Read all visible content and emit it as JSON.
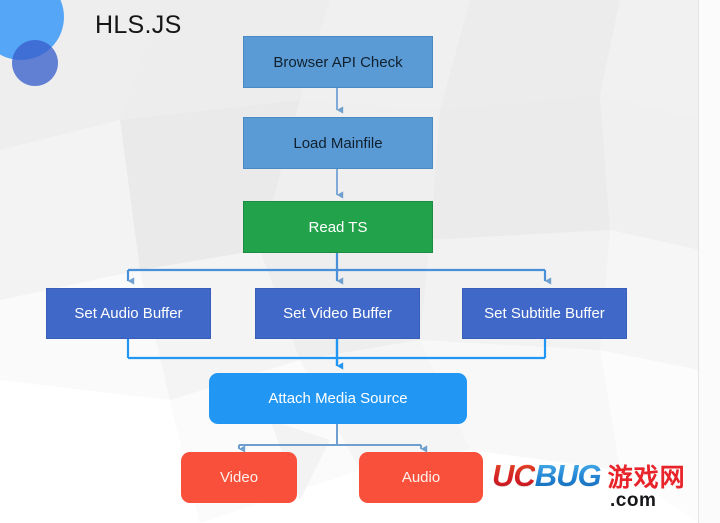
{
  "title": "HLS.JS",
  "colors": {
    "background": "#f2f2f2",
    "light_blue_box": "#5b9bd5",
    "green_box": "#22a24a",
    "indigo_box": "#4068c8",
    "bright_blue_box": "#2196f3",
    "red_box": "#f9503c",
    "connector_light": "#7fa9d6",
    "connector_bright": "#2196f3",
    "deco_circle_big": "#55a6f7",
    "deco_circle_small": "#3a60cc"
  },
  "flow": {
    "browser_api_check": "Browser API Check",
    "load_mainfile": "Load Mainfile",
    "read_ts": "Read TS",
    "set_audio_buffer": "Set Audio Buffer",
    "set_video_buffer": "Set Video Buffer",
    "set_subtitle_buffer": "Set Subtitle Buffer",
    "attach_media_source": "Attach Media Source",
    "video": "Video",
    "audio": "Audio"
  },
  "watermark": {
    "brand_first": "UC",
    "brand_second": "BUG",
    "chinese": "游戏网",
    "domain": ".com"
  }
}
